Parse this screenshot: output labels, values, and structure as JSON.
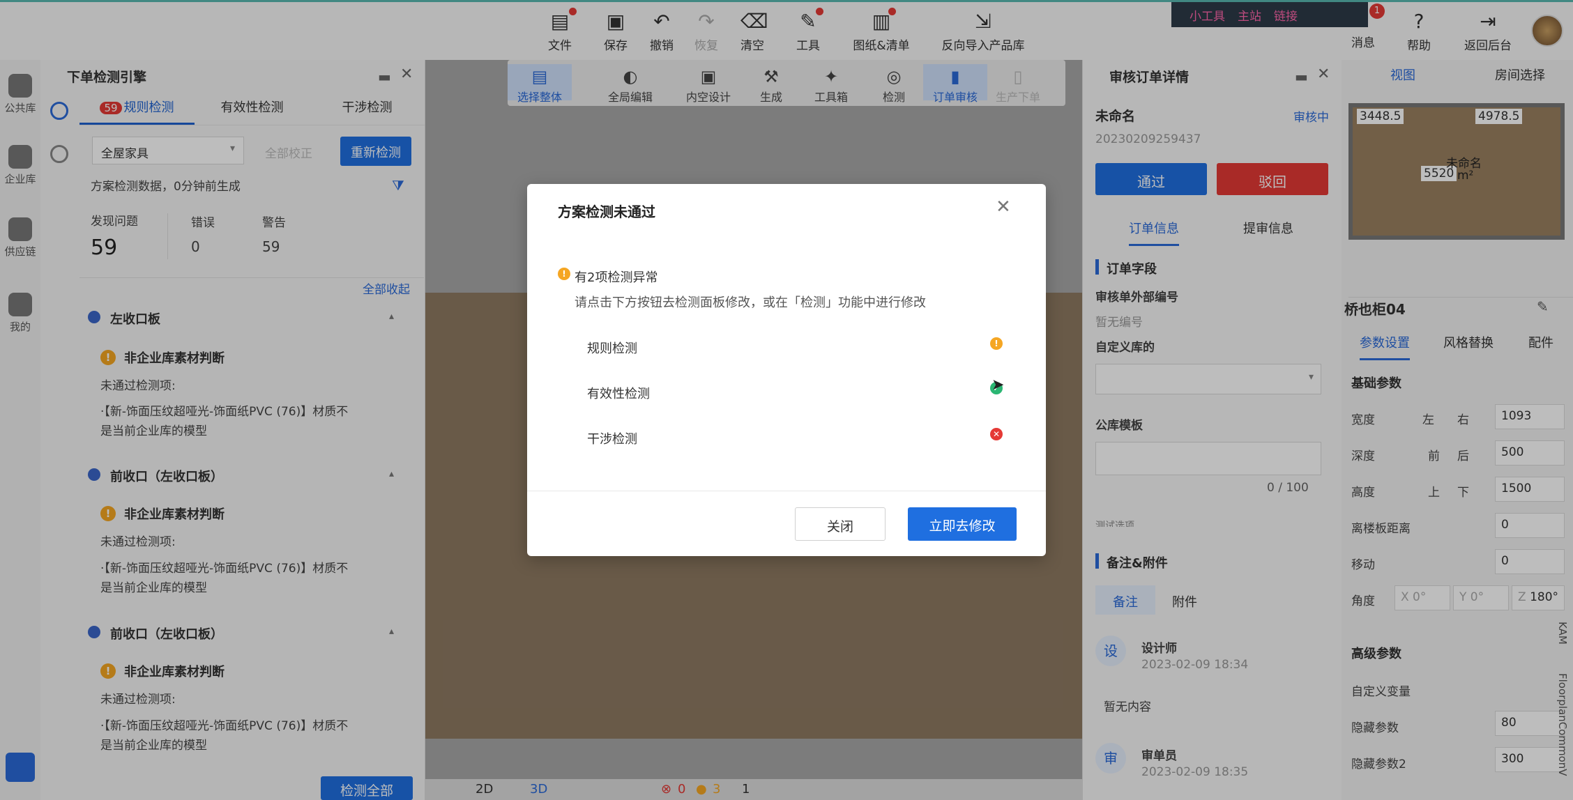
{
  "topbar": {
    "items": [
      {
        "label": "文件",
        "icon": "file-icon"
      },
      {
        "label": "保存",
        "icon": "save-icon"
      },
      {
        "label": "撤销",
        "icon": "undo-icon"
      },
      {
        "label": "恢复",
        "icon": "redo-icon"
      },
      {
        "label": "清空",
        "icon": "eraser-icon"
      },
      {
        "label": "工具",
        "icon": "wrench-icon"
      },
      {
        "label": "图纸&清单",
        "icon": "drawing-icon"
      },
      {
        "label": "反向导入产品库",
        "icon": "import-icon"
      }
    ],
    "links": [
      "小工具",
      "主站",
      "链接"
    ],
    "msg": "消息",
    "help": "帮助",
    "back": "返回后台",
    "msg_badge": "1"
  },
  "leftnav": [
    "公共库",
    "企业库",
    "供应链",
    "我的"
  ],
  "leftpanel": {
    "title": "下单检测引擎",
    "tabs": {
      "rule": "规则检测",
      "rule_count": "59",
      "valid": "有效性检测",
      "interfere": "干涉检测"
    },
    "filter": "全屋家具",
    "fixall": "全部校正",
    "recheck": "重新检测",
    "meta": "方案检测数据，0分钟前生成",
    "stats": {
      "found_label": "发现问题",
      "found": "59",
      "err_label": "错误",
      "err": "0",
      "warn_label": "警告",
      "warn": "59"
    },
    "collapse": "全部收起",
    "sections": [
      {
        "title": "左收口板",
        "issue": "非企业库素材判断",
        "fail": "未通过检测项:",
        "detail1": "·【新-饰面压纹超哑光-饰面纸PVC (76)】材质不",
        "detail2": "是当前企业库的模型"
      },
      {
        "title": "前收口（左收口板）",
        "issue": "非企业库素材判断",
        "fail": "未通过检测项:",
        "detail1": "·【新-饰面压纹超哑光-饰面纸PVC (76)】材质不",
        "detail2": "是当前企业库的模型"
      },
      {
        "title": "前收口（左收口板）",
        "issue": "非企业库素材判断",
        "fail": "未通过检测项:",
        "detail1": "·【新-饰面压纹超哑光-饰面纸PVC (76)】材质不",
        "detail2": "是当前企业库的模型"
      }
    ],
    "check_all": "检测全部"
  },
  "canvas": {
    "tools": [
      "选择整体",
      "全局编辑",
      "内空设计",
      "生成",
      "工具箱",
      "检测",
      "订单审核",
      "生产下单"
    ],
    "bottom": {
      "v2d": "2D",
      "v3d": "3D",
      "err": "0",
      "warn": "3",
      "cnt": "1"
    }
  },
  "orderpanel": {
    "title": "审核订单详情",
    "name": "未命名",
    "status": "审核中",
    "id": "20230209259437",
    "pass": "通过",
    "reject": "驳回",
    "tabs": [
      "订单信息",
      "提审信息"
    ],
    "section": "订单字段",
    "ext_label": "审核单外部编号",
    "ext_value": "暂无编号",
    "custom_label": "自定义库的",
    "public_label": "公库模板",
    "counter": "0 / 100",
    "notes_section": "备注&附件",
    "note_tabs": [
      "备注",
      "附件"
    ],
    "designer_avatar": "设",
    "designer": "设计师",
    "designer_time": "2023-02-09 18:34",
    "empty": "暂无内容",
    "auditor_avatar": "审",
    "auditor": "审单员",
    "auditor_time": "2023-02-09 18:35",
    "cut": "测试选项"
  },
  "rightpanel": {
    "tabs": [
      "视图",
      "房间选择"
    ],
    "dims": [
      "3448.5",
      "4978.5",
      "5520"
    ],
    "room": "未命名",
    "room_area": "m²",
    "obj": "桥也柜04",
    "ptabs": [
      "参数设置",
      "风格替换",
      "配件"
    ],
    "basic": "基础参数",
    "width_label": "宽度",
    "width_left": "左",
    "width_right": "右",
    "width": "1093",
    "depth_label": "深度",
    "depth_front": "前",
    "depth_back": "后",
    "depth": "500",
    "height_label": "高度",
    "height_top": "上",
    "height_bottom": "下",
    "height": "1500",
    "floor_label": "离楼板距离",
    "floor": "0",
    "move_label": "移动",
    "move": "0",
    "angle_label": "角度",
    "ax": "X 0°",
    "ay": "Y 0°",
    "az": "Z",
    "az_val": "180°",
    "advanced": "高级参数",
    "custom_var": "自定义变量",
    "hidden1_label": "隐藏参数",
    "hidden1": "80",
    "hidden2_label": "隐藏参数2",
    "hidden2": "300",
    "side": "KAM",
    "side2": "FloorplanCommonV"
  },
  "modal": {
    "title": "方案检测未通过",
    "summary": "有2项检测异常",
    "hint": "请点击下方按钮去检测面板修改，或在「检测」功能中进行修改",
    "items": [
      {
        "label": "规则检测",
        "status": "warning"
      },
      {
        "label": "有效性检测",
        "status": "pass"
      },
      {
        "label": "干涉检测",
        "status": "error"
      }
    ],
    "close": "关闭",
    "fix": "立即去修改"
  }
}
